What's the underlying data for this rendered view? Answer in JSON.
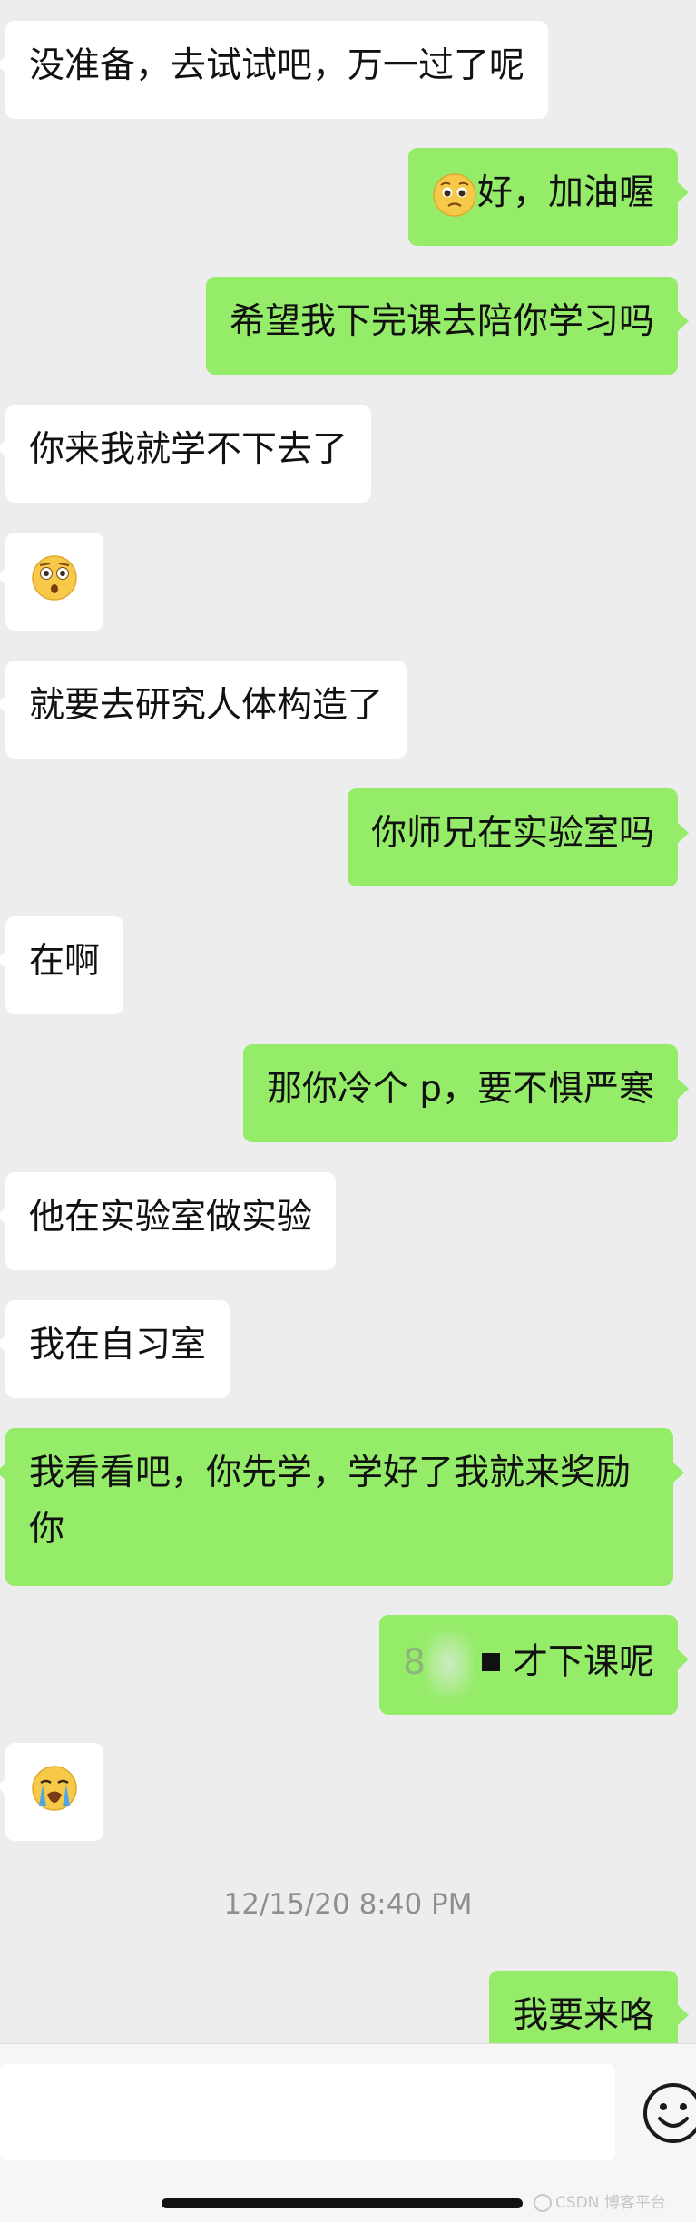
{
  "messages": [
    {
      "side": "in",
      "text": "没准备，去试试吧，万一过了呢"
    },
    {
      "side": "out",
      "emoji": "pleading-face-emoji",
      "text": "好，加油喔"
    },
    {
      "side": "out",
      "text": "希望我下完课去陪你学习吗"
    },
    {
      "side": "in",
      "text": "你来我就学不下去了"
    },
    {
      "side": "in",
      "emoji": "flushed-face-emoji"
    },
    {
      "side": "in",
      "text": "就要去研究人体构造了"
    },
    {
      "side": "out",
      "text": "你师兄在实验室吗"
    },
    {
      "side": "in",
      "text": "在啊"
    },
    {
      "side": "out",
      "text": "那你冷个 p，要不惧严寒"
    },
    {
      "side": "in",
      "text": "他在实验室做实验"
    },
    {
      "side": "in",
      "text": "我在自习室"
    },
    {
      "side": "in",
      "text": "我看看吧，你先学，学好了我就来奖励你"
    },
    {
      "side": "out",
      "text_prefix": "8",
      "text": "才下课呢"
    },
    {
      "side": "in",
      "emoji": "loudly-crying-face-emoji"
    },
    {
      "side": "out",
      "text": "我要来咯"
    }
  ],
  "timestamp": "12/15/20 8:40 PM",
  "input": {
    "value": ""
  },
  "watermark": "CSDN 博客平台",
  "colors": {
    "background": "#ededed",
    "incoming_bubble": "#ffffff",
    "outgoing_bubble": "#95ec69",
    "timestamp_text": "#8f8f8f"
  }
}
